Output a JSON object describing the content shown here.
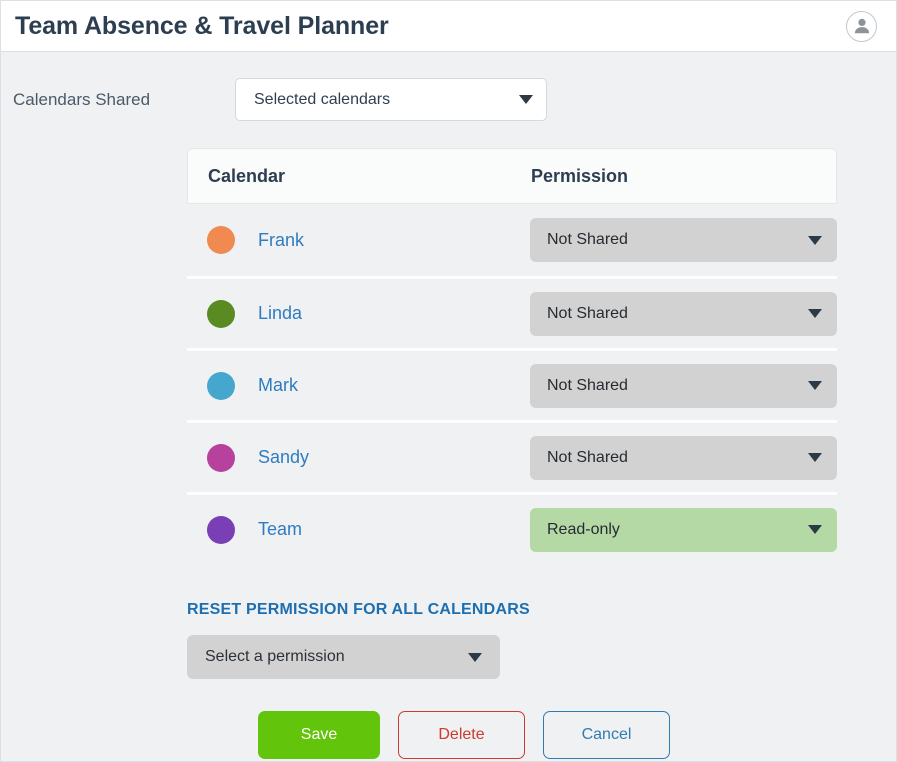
{
  "header": {
    "title": "Team Absence & Travel Planner",
    "avatar_icon": "user-avatar-icon"
  },
  "shared": {
    "label": "Calendars Shared",
    "scope_value": "Selected calendars"
  },
  "table": {
    "columns": [
      "Calendar",
      "Permission"
    ],
    "rows": [
      {
        "name": "Frank",
        "color": "#f08a50",
        "permission": "Not Shared",
        "granted": false
      },
      {
        "name": "Linda",
        "color": "#5a8a22",
        "permission": "Not Shared",
        "granted": false
      },
      {
        "name": "Mark",
        "color": "#45a6ce",
        "permission": "Not Shared",
        "granted": false
      },
      {
        "name": "Sandy",
        "color": "#b7429e",
        "permission": "Not Shared",
        "granted": false
      },
      {
        "name": "Team",
        "color": "#7a3fb5",
        "permission": "Read-only",
        "granted": true
      }
    ]
  },
  "reset": {
    "title": "RESET PERMISSION FOR ALL CALENDARS",
    "select_value": "Select a permission"
  },
  "actions": {
    "save": "Save",
    "delete": "Delete",
    "cancel": "Cancel"
  },
  "colors": {
    "accent_blue": "#1f6fb0",
    "link_blue": "#2f7cc0",
    "save_green": "#63c40c",
    "delete_red": "#cd3a30",
    "cancel_blue": "#2f7cb3",
    "granted_green": "#b5d9a4",
    "select_gray": "#d2d2d2",
    "page_bg": "#eff1f3"
  }
}
